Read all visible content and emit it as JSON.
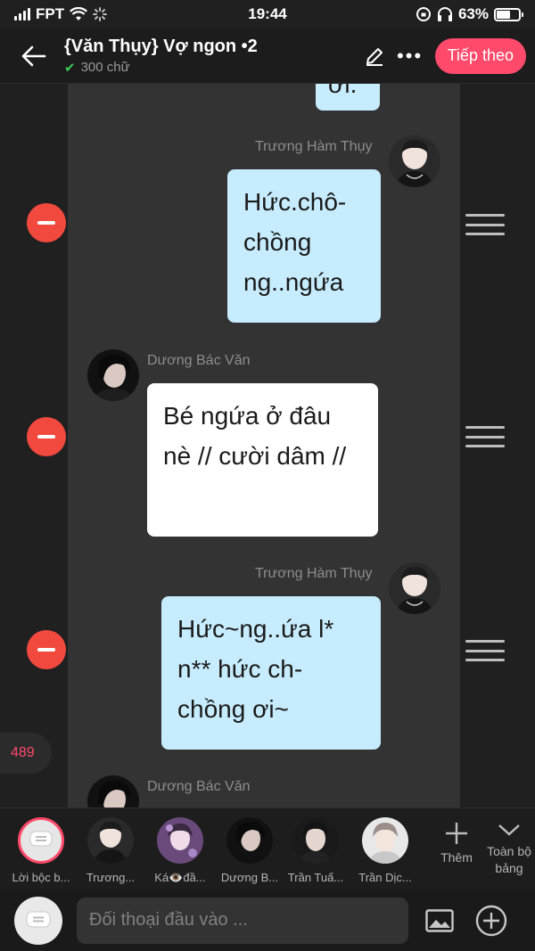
{
  "status_bar": {
    "carrier": "FPT",
    "time": "19:44",
    "battery_percent": "63%",
    "battery_level": 0.63
  },
  "header": {
    "title": "{Văn Thụy} Vợ ngon •2",
    "subtitle": "300 chữ",
    "next_label": "Tiếp theo"
  },
  "messages": [
    {
      "side": "right",
      "speaker": "",
      "text": "ơi."
    },
    {
      "side": "right",
      "speaker": "Trương Hàm Thụy",
      "text": "Hức.chô-chồng ng..ngứa"
    },
    {
      "side": "left",
      "speaker": "Dương Bác Văn",
      "text": "Bé ngứa ở đâu nè // cười dâm //"
    },
    {
      "side": "right",
      "speaker": "Trương Hàm Thụy",
      "text": "Hức~ng..ứa l* n** hức ch-chồng ơi~"
    },
    {
      "side": "left",
      "speaker": "Dương Bác Văn",
      "text": ""
    }
  ],
  "word_count_badge": "489",
  "characters": [
    {
      "label": "Lời bộc b..."
    },
    {
      "label": "Trương..."
    },
    {
      "label": "Ká👁️đầ..."
    },
    {
      "label": "Dương B..."
    },
    {
      "label": "Trần Tuấ..."
    },
    {
      "label": "Trần Dịc..."
    }
  ],
  "strip_actions": {
    "add_label": "Thêm",
    "all_label": "Toàn bộ bảng"
  },
  "input": {
    "placeholder": "Đối thoại đầu vào ..."
  },
  "colors": {
    "accent": "#ff4a6b",
    "bubble_self": "#c6ecfd",
    "bubble_other": "#ffffff",
    "delete": "#f2493f"
  }
}
